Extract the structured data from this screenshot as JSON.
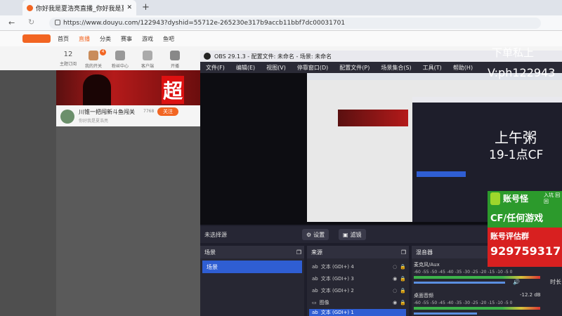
{
  "browser": {
    "tab_title": "你好我是夏浩亮直播_你好我是夏浩",
    "new_tab": "+",
    "url": "https://www.douyu.com/122943?dyshid=55712e-265230e317b9accb11bbf7dc00031701"
  },
  "douyu": {
    "nav": [
      "首页",
      "直播",
      "分类",
      "赛事",
      "游戏",
      "鱼吧"
    ],
    "sub": [
      {
        "label": "主题订阅"
      },
      {
        "label": "我的开关"
      },
      {
        "label": "粉丝中心"
      },
      {
        "label": "客户端"
      },
      {
        "label": "开播"
      }
    ],
    "date_num": "12",
    "badge": "4",
    "banner_text": "超",
    "anchor_title": "川锥一把闯新斗鱼闯关",
    "anchor_sub": "你好我是夏浩亮",
    "anchor_level": "7768",
    "follow": "关注"
  },
  "obs": {
    "title": "OBS 29.1.3 - 配置文件: 未命名 - 场景: 未命名",
    "menu": [
      "文件(F)",
      "编辑(E)",
      "视图(V)",
      "停靠窗口(D)",
      "配置文件(P)",
      "场景集合(S)",
      "工具(T)",
      "帮助(H)"
    ],
    "no_source": "未选择源",
    "settings_btn": "设置",
    "filter_btn": "滤镜",
    "scenes_header": "场景",
    "scene_item": "场景",
    "sources_header": "来源",
    "sources": [
      {
        "label": "文本 (GDI+) 4",
        "icon": "text-icon"
      },
      {
        "label": "文本 (GDI+) 3",
        "icon": "text-icon"
      },
      {
        "label": "文本 (GDI+) 2",
        "icon": "text-icon"
      },
      {
        "label": "图像",
        "icon": "image-icon"
      },
      {
        "label": "文本 (GDI+) 1",
        "icon": "text-icon"
      }
    ],
    "mixer_header": "混音器",
    "mic_label": "麦克风/Aux",
    "desktop_label": "桌面音频",
    "desktop_db": "-12.2 dB",
    "scale": "-60 -55 -50 -45 -40 -35 -30 -25 -20 -15 -10 -5 0",
    "extra": "时长"
  },
  "overlay": {
    "line1": "下单私上",
    "line2": "V:ph122943",
    "line3": "上午粥",
    "line4": "19-1点CF",
    "ad1": "账号怪",
    "ad2": "CF/任何游戏",
    "ad3": "账号评估群",
    "ad4": "929759317",
    "ad_side": "入坑 回回"
  }
}
